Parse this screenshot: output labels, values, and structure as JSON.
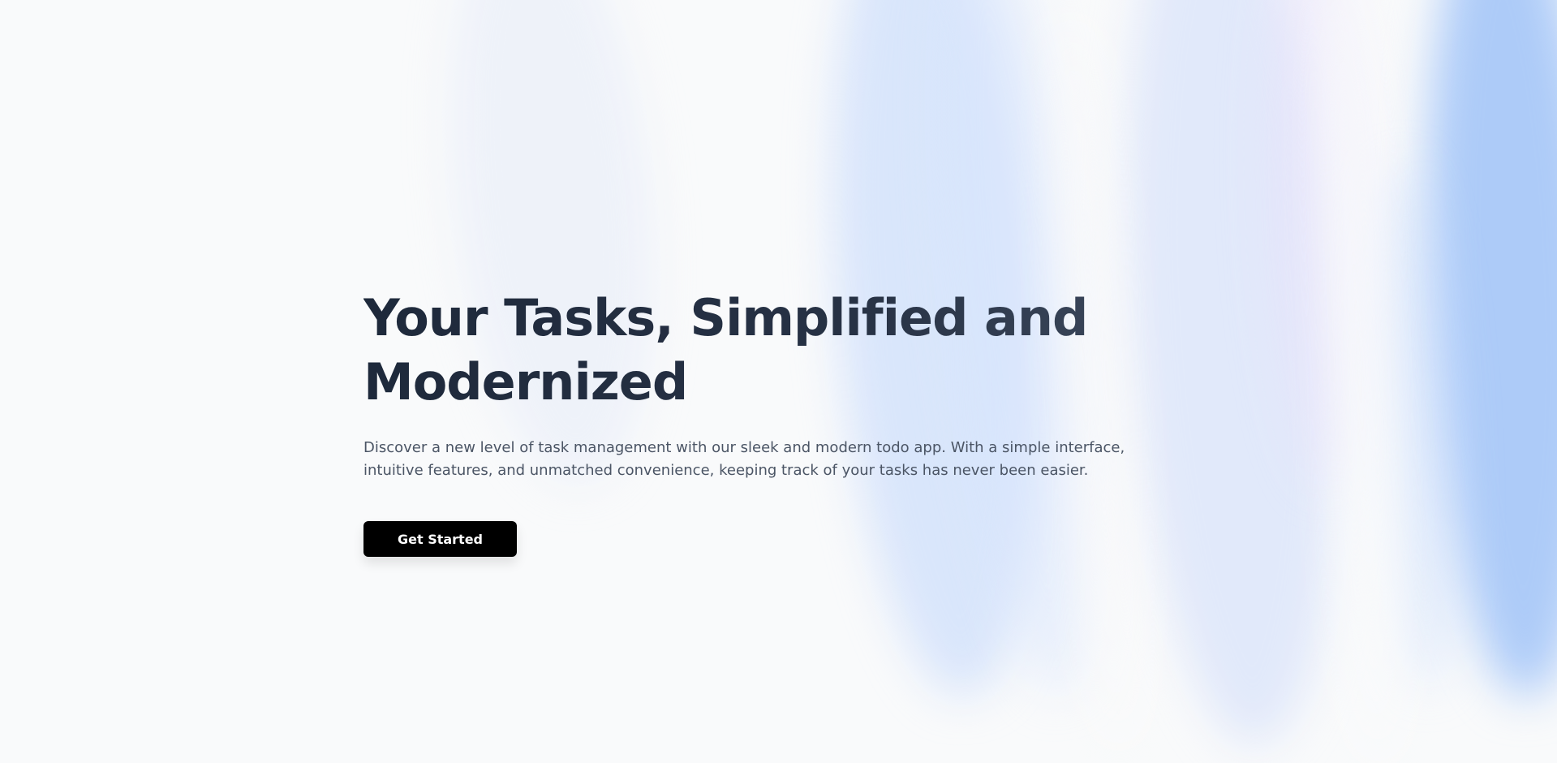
{
  "hero": {
    "title": "Your Tasks, Simplified and Modernized",
    "description": "Discover a new level of task management with our sleek and modern todo app. With a simple interface, intuitive features, and unmatched convenience, keeping track of your tasks has never been easier.",
    "cta_label": "Get Started"
  },
  "colors": {
    "background": "#f9fafb",
    "title": "#1f2737",
    "description": "#4b5565",
    "button_background": "#000000",
    "button_text": "#ffffff",
    "accent_streak": "#a0c3f8"
  }
}
